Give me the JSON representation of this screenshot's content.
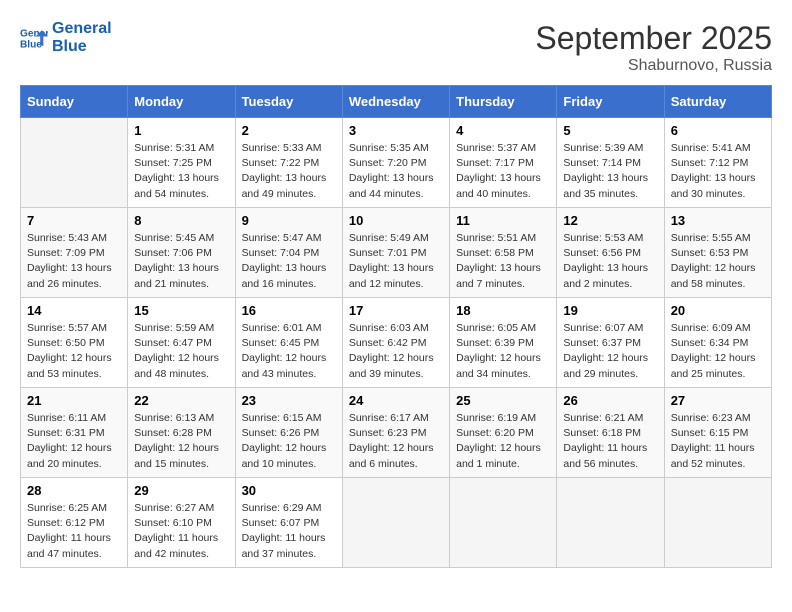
{
  "header": {
    "logo_line1": "General",
    "logo_line2": "Blue",
    "month": "September 2025",
    "location": "Shaburnovo, Russia"
  },
  "weekdays": [
    "Sunday",
    "Monday",
    "Tuesday",
    "Wednesday",
    "Thursday",
    "Friday",
    "Saturday"
  ],
  "weeks": [
    [
      {
        "day": "",
        "info": ""
      },
      {
        "day": "1",
        "info": "Sunrise: 5:31 AM\nSunset: 7:25 PM\nDaylight: 13 hours\nand 54 minutes."
      },
      {
        "day": "2",
        "info": "Sunrise: 5:33 AM\nSunset: 7:22 PM\nDaylight: 13 hours\nand 49 minutes."
      },
      {
        "day": "3",
        "info": "Sunrise: 5:35 AM\nSunset: 7:20 PM\nDaylight: 13 hours\nand 44 minutes."
      },
      {
        "day": "4",
        "info": "Sunrise: 5:37 AM\nSunset: 7:17 PM\nDaylight: 13 hours\nand 40 minutes."
      },
      {
        "day": "5",
        "info": "Sunrise: 5:39 AM\nSunset: 7:14 PM\nDaylight: 13 hours\nand 35 minutes."
      },
      {
        "day": "6",
        "info": "Sunrise: 5:41 AM\nSunset: 7:12 PM\nDaylight: 13 hours\nand 30 minutes."
      }
    ],
    [
      {
        "day": "7",
        "info": "Sunrise: 5:43 AM\nSunset: 7:09 PM\nDaylight: 13 hours\nand 26 minutes."
      },
      {
        "day": "8",
        "info": "Sunrise: 5:45 AM\nSunset: 7:06 PM\nDaylight: 13 hours\nand 21 minutes."
      },
      {
        "day": "9",
        "info": "Sunrise: 5:47 AM\nSunset: 7:04 PM\nDaylight: 13 hours\nand 16 minutes."
      },
      {
        "day": "10",
        "info": "Sunrise: 5:49 AM\nSunset: 7:01 PM\nDaylight: 13 hours\nand 12 minutes."
      },
      {
        "day": "11",
        "info": "Sunrise: 5:51 AM\nSunset: 6:58 PM\nDaylight: 13 hours\nand 7 minutes."
      },
      {
        "day": "12",
        "info": "Sunrise: 5:53 AM\nSunset: 6:56 PM\nDaylight: 13 hours\nand 2 minutes."
      },
      {
        "day": "13",
        "info": "Sunrise: 5:55 AM\nSunset: 6:53 PM\nDaylight: 12 hours\nand 58 minutes."
      }
    ],
    [
      {
        "day": "14",
        "info": "Sunrise: 5:57 AM\nSunset: 6:50 PM\nDaylight: 12 hours\nand 53 minutes."
      },
      {
        "day": "15",
        "info": "Sunrise: 5:59 AM\nSunset: 6:47 PM\nDaylight: 12 hours\nand 48 minutes."
      },
      {
        "day": "16",
        "info": "Sunrise: 6:01 AM\nSunset: 6:45 PM\nDaylight: 12 hours\nand 43 minutes."
      },
      {
        "day": "17",
        "info": "Sunrise: 6:03 AM\nSunset: 6:42 PM\nDaylight: 12 hours\nand 39 minutes."
      },
      {
        "day": "18",
        "info": "Sunrise: 6:05 AM\nSunset: 6:39 PM\nDaylight: 12 hours\nand 34 minutes."
      },
      {
        "day": "19",
        "info": "Sunrise: 6:07 AM\nSunset: 6:37 PM\nDaylight: 12 hours\nand 29 minutes."
      },
      {
        "day": "20",
        "info": "Sunrise: 6:09 AM\nSunset: 6:34 PM\nDaylight: 12 hours\nand 25 minutes."
      }
    ],
    [
      {
        "day": "21",
        "info": "Sunrise: 6:11 AM\nSunset: 6:31 PM\nDaylight: 12 hours\nand 20 minutes."
      },
      {
        "day": "22",
        "info": "Sunrise: 6:13 AM\nSunset: 6:28 PM\nDaylight: 12 hours\nand 15 minutes."
      },
      {
        "day": "23",
        "info": "Sunrise: 6:15 AM\nSunset: 6:26 PM\nDaylight: 12 hours\nand 10 minutes."
      },
      {
        "day": "24",
        "info": "Sunrise: 6:17 AM\nSunset: 6:23 PM\nDaylight: 12 hours\nand 6 minutes."
      },
      {
        "day": "25",
        "info": "Sunrise: 6:19 AM\nSunset: 6:20 PM\nDaylight: 12 hours\nand 1 minute."
      },
      {
        "day": "26",
        "info": "Sunrise: 6:21 AM\nSunset: 6:18 PM\nDaylight: 11 hours\nand 56 minutes."
      },
      {
        "day": "27",
        "info": "Sunrise: 6:23 AM\nSunset: 6:15 PM\nDaylight: 11 hours\nand 52 minutes."
      }
    ],
    [
      {
        "day": "28",
        "info": "Sunrise: 6:25 AM\nSunset: 6:12 PM\nDaylight: 11 hours\nand 47 minutes."
      },
      {
        "day": "29",
        "info": "Sunrise: 6:27 AM\nSunset: 6:10 PM\nDaylight: 11 hours\nand 42 minutes."
      },
      {
        "day": "30",
        "info": "Sunrise: 6:29 AM\nSunset: 6:07 PM\nDaylight: 11 hours\nand 37 minutes."
      },
      {
        "day": "",
        "info": ""
      },
      {
        "day": "",
        "info": ""
      },
      {
        "day": "",
        "info": ""
      },
      {
        "day": "",
        "info": ""
      }
    ]
  ]
}
